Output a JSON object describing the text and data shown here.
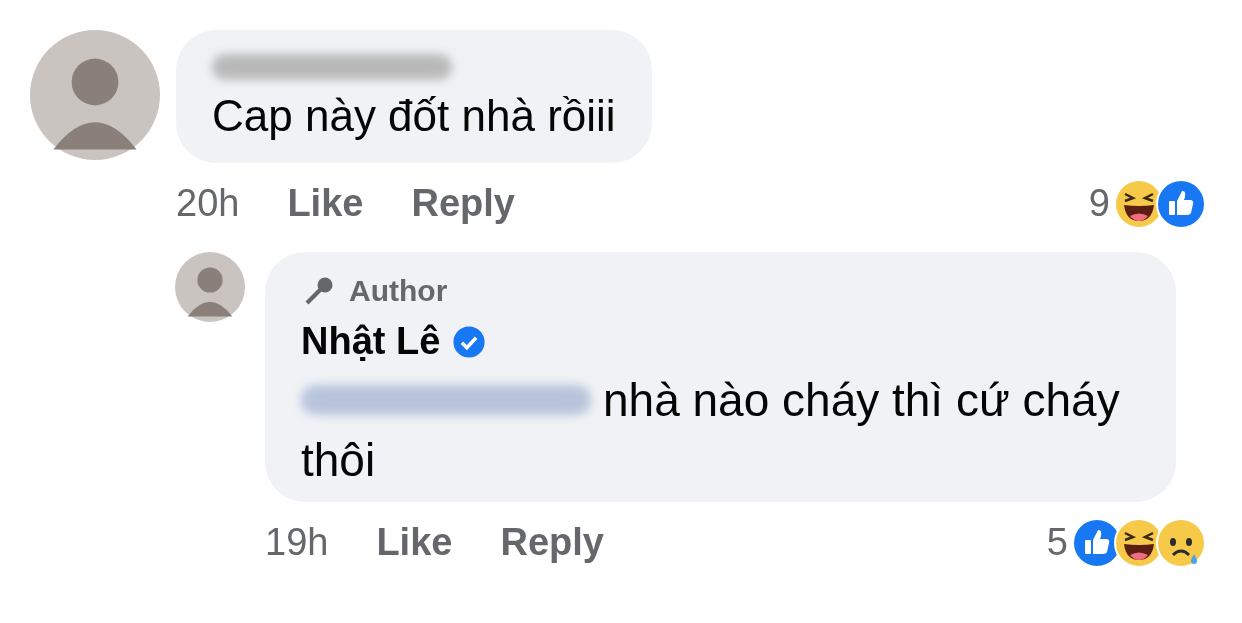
{
  "comment": {
    "text": "Cap này đốt nhà rồiii",
    "time": "20h",
    "actions": [
      "Like",
      "Reply"
    ],
    "reaction_count": "9",
    "reactions": [
      {
        "kind": "haha"
      },
      {
        "kind": "like"
      }
    ]
  },
  "reply": {
    "badge": "Author",
    "author": "Nhật Lê",
    "verified": true,
    "text_lines": [
      "nhà nào cháy thì cứ cháy",
      "thôi"
    ],
    "time": "19h",
    "actions": [
      "Like",
      "Reply"
    ],
    "reaction_count": "5",
    "reactions": [
      {
        "kind": "like"
      },
      {
        "kind": "haha"
      },
      {
        "kind": "sad"
      }
    ]
  }
}
